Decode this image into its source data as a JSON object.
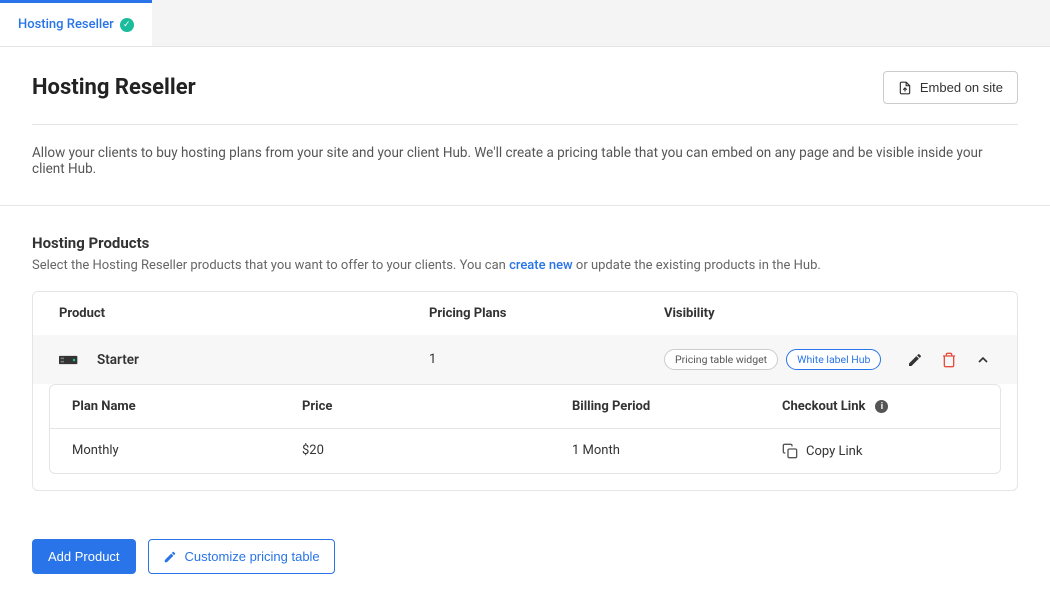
{
  "tab": {
    "label": "Hosting Reseller"
  },
  "header": {
    "title": "Hosting Reseller",
    "embed_label": "Embed on site"
  },
  "description": "Allow your clients to buy hosting plans from your site and your client Hub. We'll create a pricing table that you can embed on any page and be visible inside your client Hub.",
  "products_section": {
    "title": "Hosting Products",
    "subtitle_prefix": "Select the Hosting Reseller products that you want to offer to your clients. You can ",
    "create_new_link": "create new",
    "subtitle_suffix": " or update the existing products in the Hub."
  },
  "table": {
    "headers": {
      "product": "Product",
      "pricing_plans": "Pricing Plans",
      "visibility": "Visibility"
    },
    "product": {
      "name": "Starter",
      "plan_count": "1",
      "badges": {
        "widget": "Pricing table widget",
        "hub": "White label Hub"
      }
    },
    "sub": {
      "headers": {
        "plan_name": "Plan Name",
        "price": "Price",
        "billing_period": "Billing Period",
        "checkout": "Checkout Link"
      },
      "row": {
        "plan_name": "Monthly",
        "price": "$20",
        "billing_period": "1 Month",
        "copy_link": "Copy Link"
      }
    }
  },
  "footer": {
    "add_product": "Add Product",
    "customize": "Customize pricing table"
  }
}
